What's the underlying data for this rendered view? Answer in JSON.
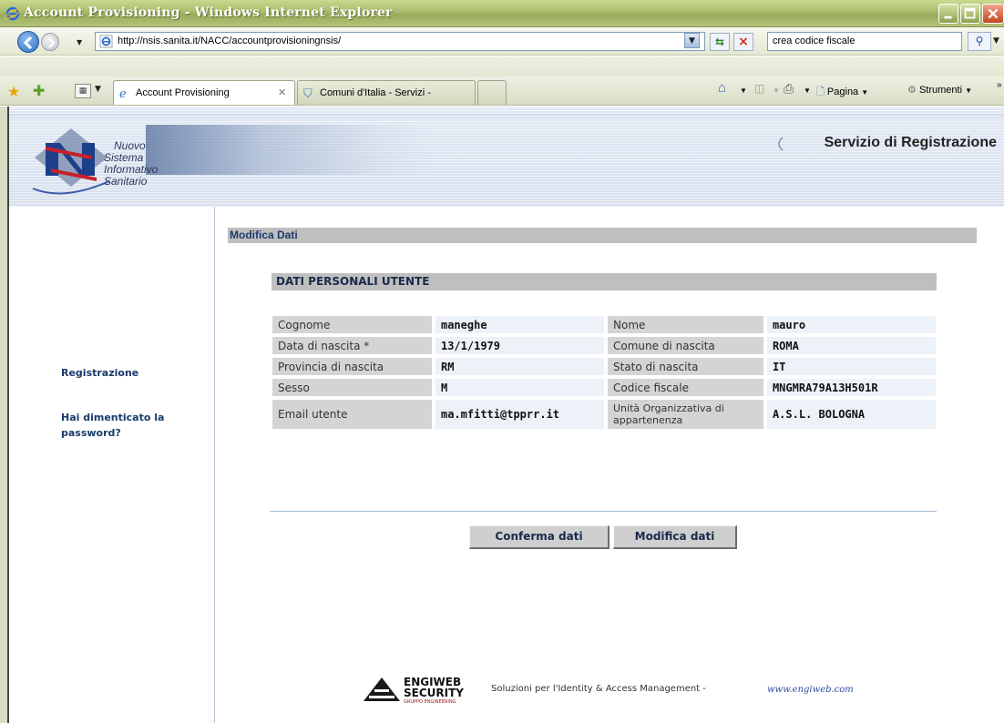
{
  "window": {
    "title": "Account Provisioning - Windows Internet Explorer"
  },
  "address_bar": {
    "url": "http://nsis.sanita.it/NACC/accountprovisioningnsis/",
    "search_value": "crea codice fiscale"
  },
  "tabs": [
    {
      "label": "Account Provisioning",
      "active": true
    },
    {
      "label": "Comuni d'Italia - Servizi -",
      "active": false
    }
  ],
  "command_bar": {
    "page_label": "Pagina",
    "tools_label": "Strumenti",
    "more_label": "»"
  },
  "header": {
    "logo_lines": [
      "Nuovo",
      "Sistema",
      "Informativo",
      "Sanitario"
    ],
    "service_title": "Servizio di Registrazione"
  },
  "leftnav": {
    "items": [
      {
        "label": "Registrazione"
      },
      {
        "label": "Hai dimenticato la password?"
      }
    ]
  },
  "main": {
    "section_title": "Modifica Dati",
    "subsection_title": "DATI PERSONALI UTENTE",
    "rows": [
      {
        "label1": "Cognome",
        "value1": "maneghe",
        "label2": "Nome",
        "value2": "mauro"
      },
      {
        "label1": "Data di nascita *",
        "value1": "13/1/1979",
        "label2": "Comune di nascita",
        "value2": "ROMA"
      },
      {
        "label1": "Provincia di nascita",
        "value1": "RM",
        "label2": "Stato di nascita",
        "value2": "IT"
      },
      {
        "label1": "Sesso",
        "value1": "M",
        "label2": "Codice fiscale",
        "value2": "MNGMRA79A13H501R"
      },
      {
        "label1": "Email utente",
        "value1": "ma.mfitti@tpprr.it",
        "label2": "Unità Organizzativa di appartenenza",
        "value2": "A.S.L. BOLOGNA"
      }
    ],
    "confirm_button": "Conferma dati",
    "modify_button": "Modifica dati"
  },
  "footer": {
    "brand_line1": "ENGIWEB",
    "brand_line2": "SECURITY",
    "brand_line3": "GRUPPO ENGINEERING",
    "tagline": "Soluzioni per l'Identity & Access Management  -",
    "link": "www.engiweb.com"
  },
  "colors": {
    "titlebar": "#a9bb6c",
    "nav_link": "#1a3a6a",
    "section_bar": "#bfbfbf",
    "label_cell": "#d4d4d4",
    "value_cell": "#edf2f8"
  }
}
